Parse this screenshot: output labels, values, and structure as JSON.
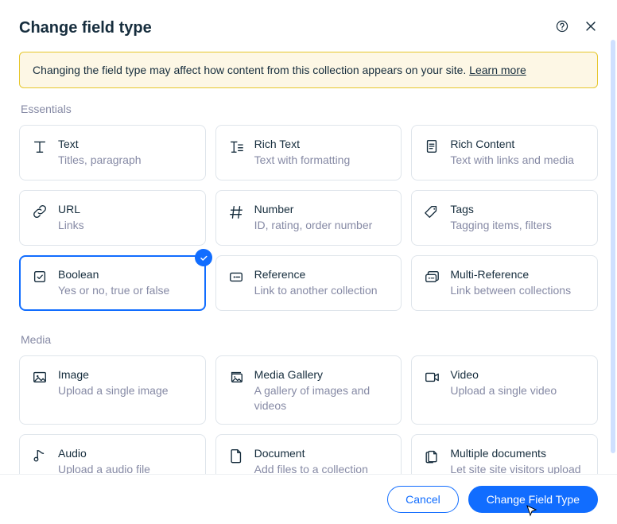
{
  "title": "Change field type",
  "warning": {
    "text_before": "Changing the field type may affect how content from this collection appears on your site. ",
    "link": "Learn more"
  },
  "sections": [
    {
      "label": "Essentials",
      "items": [
        {
          "id": "text",
          "icon": "text-icon",
          "name": "Text",
          "desc": "Titles, paragraph"
        },
        {
          "id": "rich-text",
          "icon": "rich-text-icon",
          "name": "Rich Text",
          "desc": "Text with formatting"
        },
        {
          "id": "rich-content",
          "icon": "document-icon",
          "name": "Rich Content",
          "desc": "Text with links and media"
        },
        {
          "id": "url",
          "icon": "link-icon",
          "name": "URL",
          "desc": "Links"
        },
        {
          "id": "number",
          "icon": "hash-icon",
          "name": "Number",
          "desc": "ID, rating, order number"
        },
        {
          "id": "tags",
          "icon": "tag-icon",
          "name": "Tags",
          "desc": "Tagging items, filters"
        },
        {
          "id": "boolean",
          "icon": "checkbox-icon",
          "name": "Boolean",
          "desc": "Yes or no, true or false",
          "selected": true
        },
        {
          "id": "reference",
          "icon": "reference-icon",
          "name": "Reference",
          "desc": "Link to another collection"
        },
        {
          "id": "multi-reference",
          "icon": "multi-ref-icon",
          "name": "Multi-Reference",
          "desc": "Link between collections"
        }
      ]
    },
    {
      "label": "Media",
      "items": [
        {
          "id": "image",
          "icon": "image-icon",
          "name": "Image",
          "desc": "Upload a single image"
        },
        {
          "id": "media-gallery",
          "icon": "gallery-icon",
          "name": "Media Gallery",
          "desc": "A gallery of images and videos"
        },
        {
          "id": "video",
          "icon": "video-icon",
          "name": "Video",
          "desc": "Upload a single video"
        },
        {
          "id": "audio",
          "icon": "audio-icon",
          "name": "Audio",
          "desc": "Upload a audio file"
        },
        {
          "id": "document",
          "icon": "file-icon",
          "name": "Document",
          "desc": "Add files to a collection"
        },
        {
          "id": "multi-document",
          "icon": "multi-file-icon",
          "name": "Multiple documents",
          "desc": "Let site site visitors upload files to a collection"
        }
      ]
    }
  ],
  "footer": {
    "cancel": "Cancel",
    "submit": "Change Field Type"
  }
}
